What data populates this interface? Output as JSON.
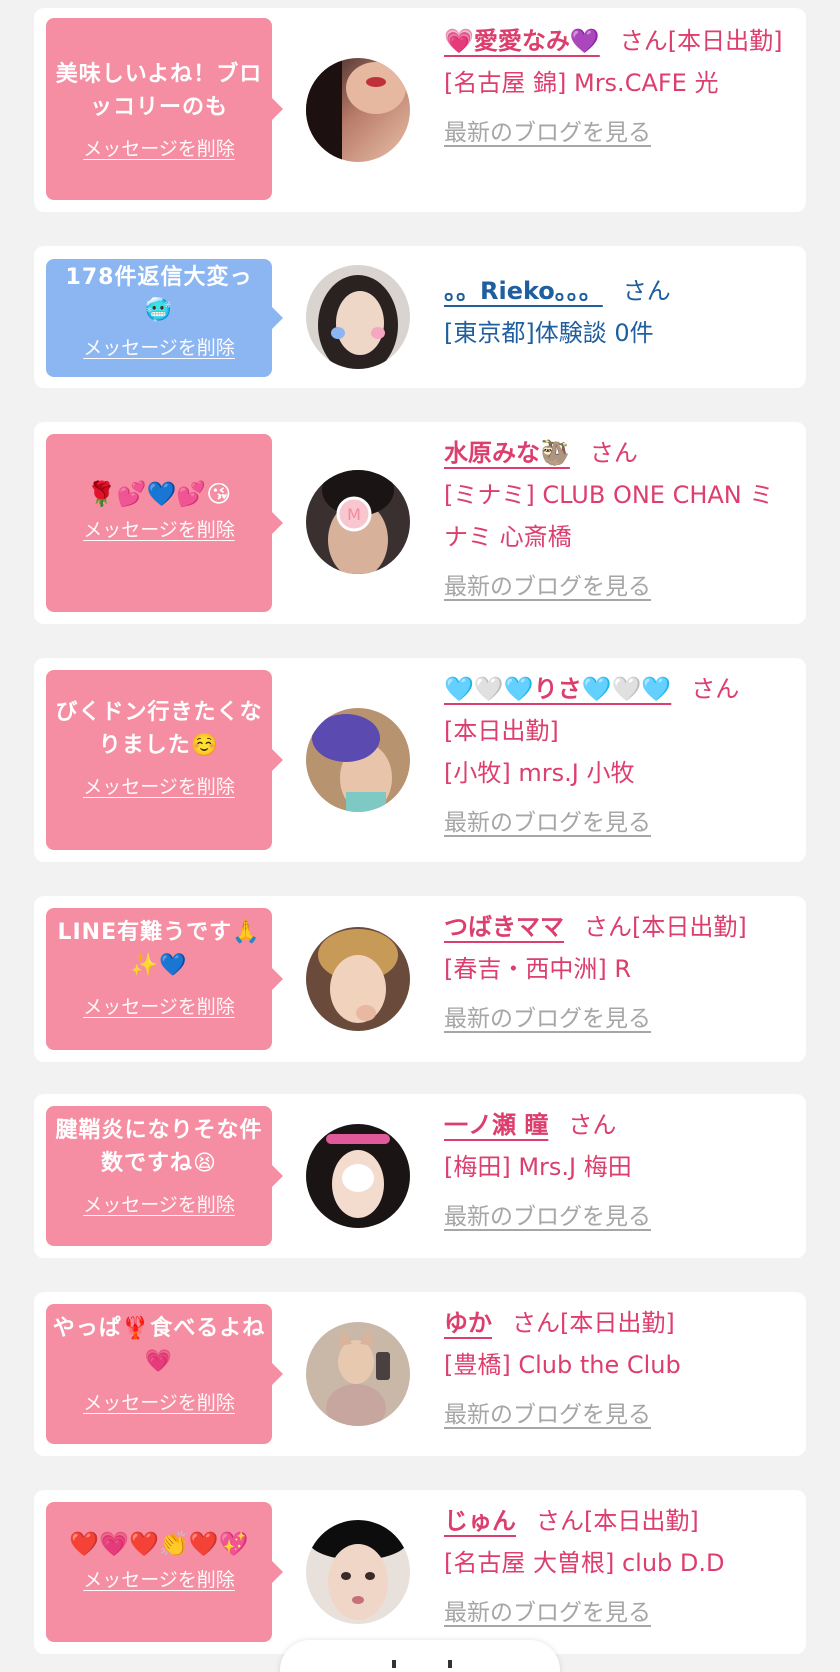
{
  "entries": [
    {
      "bubble": "美味しいよね！ブロッコリーのも",
      "bubble_color": "pink",
      "delete_label": "メッセージを削除",
      "name": "💗愛愛なみ💜",
      "san": "さん",
      "extra": "[本日出勤]",
      "shop": "[名古屋 錦] Mrs.CAFE 光",
      "blog": "最新のブログを見る"
    },
    {
      "bubble": "178件返信大変っ🥶",
      "bubble_color": "blue",
      "delete_label": "メッセージを削除",
      "name": "。。Rieko。。。",
      "san": "さん",
      "extra": "",
      "shop": "[東京都]体験談 0件",
      "blog": ""
    },
    {
      "bubble": "🌹💕💙💕😘",
      "bubble_color": "pink",
      "delete_label": "メッセージを削除",
      "name": "水原みな🦥",
      "san": "さん",
      "extra": "",
      "shop": "[ミナミ] CLUB ONE CHAN ミナミ 心斎橋",
      "blog": "最新のブログを見る"
    },
    {
      "bubble": "びくドン行きたくなりました☺️",
      "bubble_color": "pink",
      "delete_label": "メッセージを削除",
      "name": "🩵🤍🩵りさ🩵🤍🩵",
      "san": "さん",
      "extra": "[本日出勤]",
      "shop": "[小牧] mrs.J 小牧",
      "blog": "最新のブログを見る"
    },
    {
      "bubble": "LINE有難うです🙏✨💙",
      "bubble_color": "pink",
      "delete_label": "メッセージを削除",
      "name": "つばきママ",
      "san": "さん",
      "extra": "[本日出勤]",
      "shop": "[春吉・西中洲] R",
      "blog": "最新のブログを見る"
    },
    {
      "bubble": "腱鞘炎になりそな件数ですね😫",
      "bubble_color": "pink",
      "delete_label": "メッセージを削除",
      "name": "一ノ瀬 瞳",
      "san": "さん",
      "extra": "",
      "shop": "[梅田] Mrs.J 梅田",
      "blog": "最新のブログを見る"
    },
    {
      "bubble": "やっぱ🦞食べるよね💗",
      "bubble_color": "pink",
      "delete_label": "メッセージを削除",
      "name": "ゆか",
      "san": "さん",
      "extra": "[本日出勤]",
      "shop": "[豊橋] Club the Club",
      "blog": "最新のブログを見る"
    },
    {
      "bubble": "❤️💗❤️👏❤️💖",
      "bubble_color": "pink",
      "delete_label": "メッセージを削除",
      "name": "じゅん",
      "san": "さん",
      "extra": "[本日出勤]",
      "shop": "[名古屋 大曽根] club D.D",
      "blog": "最新のブログを見る"
    }
  ],
  "colors": {
    "pink_bubble": "#f58ea2",
    "blue_bubble": "#8cb6f2",
    "name_pink": "#dc3e6e",
    "name_blue": "#1f5f9f",
    "blog_gray": "#a6a6a6",
    "background": "#f2f2f2"
  }
}
